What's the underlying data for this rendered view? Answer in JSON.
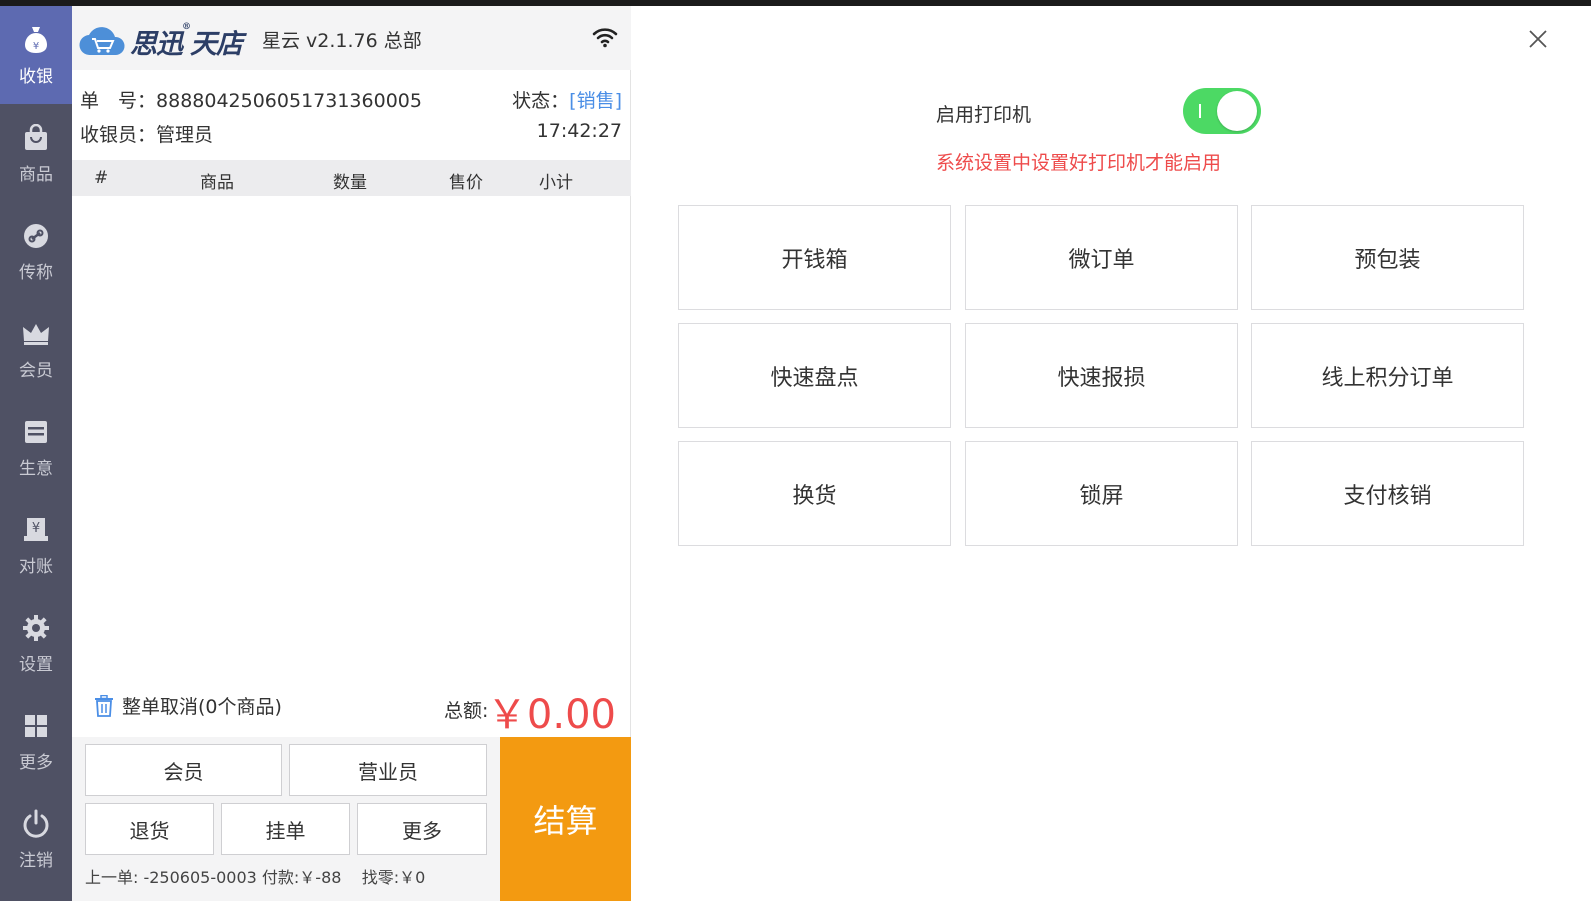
{
  "sidebar": {
    "items": [
      {
        "label": "收银",
        "icon": "money-bag-icon"
      },
      {
        "label": "商品",
        "icon": "shopping-bag-icon"
      },
      {
        "label": "传称",
        "icon": "link-icon"
      },
      {
        "label": "会员",
        "icon": "crown-icon"
      },
      {
        "label": "生意",
        "icon": "ledger-icon"
      },
      {
        "label": "对账",
        "icon": "reconcile-icon"
      },
      {
        "label": "设置",
        "icon": "gear-icon"
      },
      {
        "label": "更多",
        "icon": "grid-icon"
      },
      {
        "label": "注销",
        "icon": "power-icon"
      }
    ]
  },
  "header": {
    "logo_text": "思迅",
    "logo_text2": "天店",
    "version": "星云 v2.1.76  总部"
  },
  "order": {
    "number_label": "单　号：",
    "number_value": "8888042506051731360005",
    "status_label": "状态：",
    "status_value": "[销售]",
    "cashier_label": "收银员：",
    "cashier_value": "管理员",
    "time": "17:42:27"
  },
  "table": {
    "columns": [
      "#",
      "商品",
      "数量",
      "售价",
      "小计"
    ],
    "rows": []
  },
  "summary": {
    "cancel_label": "整单取消(0个商品)",
    "total_label": "总额:",
    "total_value": "￥0.00"
  },
  "actions": {
    "member": "会员",
    "salesperson": "营业员",
    "return": "退货",
    "hold": "挂单",
    "more": "更多",
    "checkout": "结算"
  },
  "last_order": {
    "text": "上一单: -250605-0003 付款:￥-88",
    "change": "找零:￥0"
  },
  "printer": {
    "label": "启用打印机",
    "enabled": true,
    "hint": "系统设置中设置好打印机才能启用"
  },
  "functions": [
    "开钱箱",
    "微订单",
    "预包装",
    "快速盘点",
    "快速报损",
    "线上积分订单",
    "换货",
    "锁屏",
    "支付核销"
  ],
  "colors": {
    "sidebar_bg": "#4f5164",
    "sidebar_active": "#5d6ab1",
    "accent_orange": "#f39a11",
    "total_red": "#ee4b4b",
    "status_blue": "#4a8ee6",
    "toggle_green": "#4cd964"
  }
}
